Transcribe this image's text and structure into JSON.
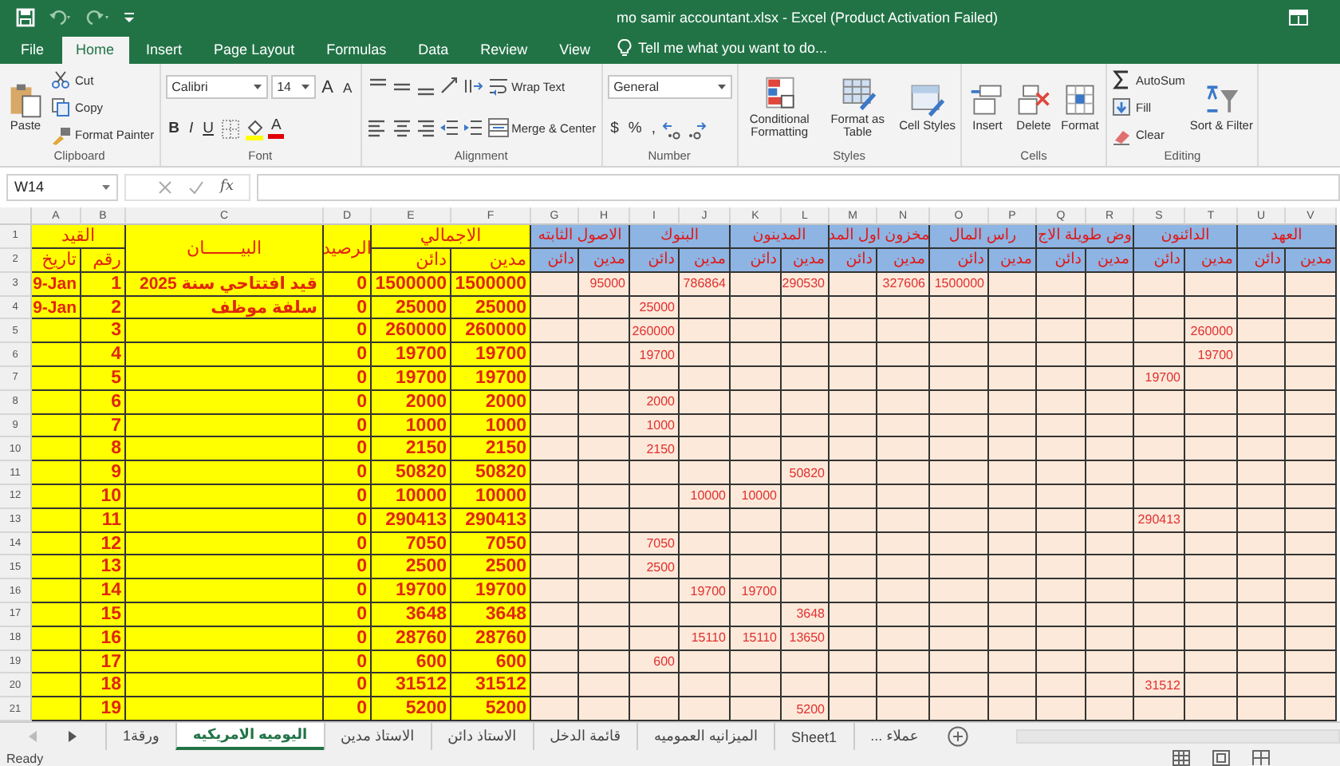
{
  "window": {
    "title": "mo samir accountant.xlsx - Excel (Product Activation Failed)"
  },
  "ribbon_tabs": [
    {
      "label": "File",
      "selected": false
    },
    {
      "label": "Home",
      "selected": true
    },
    {
      "label": "Insert",
      "selected": false
    },
    {
      "label": "Page Layout",
      "selected": false
    },
    {
      "label": "Formulas",
      "selected": false
    },
    {
      "label": "Data",
      "selected": false
    },
    {
      "label": "Review",
      "selected": false
    },
    {
      "label": "View",
      "selected": false
    }
  ],
  "tell_me": {
    "placeholder": "Tell me what you want to do..."
  },
  "ribbon": {
    "groups": [
      {
        "label": "Clipboard",
        "columns": [
          [
            {
              "kind": "large",
              "label": "Paste"
            }
          ],
          [
            {
              "kind": "small",
              "label": "Cut"
            },
            {
              "kind": "small",
              "label": "Copy"
            },
            {
              "kind": "small",
              "label": "Format Painter"
            }
          ]
        ]
      },
      {
        "label": "Font",
        "columns": [
          [
            {
              "kind": "tools",
              "tools": [
                {
                  "kind": "field",
                  "value": "Calibri"
                },
                {
                  "kind": "field",
                  "value": "14"
                },
                {
                  "kind": "text",
                  "label": "A"
                },
                {
                  "kind": "text",
                  "label": "A"
                }
              ]
            },
            {
              "kind": "tools",
              "tools": [
                {
                  "kind": "text",
                  "label": "B"
                },
                {
                  "kind": "text",
                  "label": "I"
                },
                {
                  "kind": "text",
                  "label": "U"
                },
                {
                  "kind": "icon"
                },
                {
                  "kind": "icon"
                },
                {
                  "kind": "swatch",
                  "label": "A"
                }
              ]
            }
          ]
        ]
      },
      {
        "label": "Alignment",
        "columns": [
          [
            {
              "kind": "tools",
              "tools": [
                {
                  "kind": "icon"
                },
                {
                  "kind": "icon"
                },
                {
                  "kind": "icon"
                },
                {
                  "kind": "icon"
                },
                {
                  "kind": "icon"
                }
              ]
            },
            {
              "kind": "tools",
              "tools": [
                {
                  "kind": "icon"
                },
                {
                  "kind": "icon"
                },
                {
                  "kind": "icon"
                },
                {
                  "kind": "icon"
                },
                {
                  "kind": "icon"
                }
              ]
            }
          ],
          [
            {
              "kind": "small",
              "label": "Wrap Text"
            },
            {
              "kind": "small",
              "label": "Merge & Center"
            }
          ]
        ]
      },
      {
        "label": "Number",
        "columns": [
          [
            {
              "kind": "tools",
              "tools": [
                {
                  "kind": "field",
                  "value": "General"
                }
              ]
            },
            {
              "kind": "tools",
              "tools": [
                {
                  "kind": "text",
                  "label": "$"
                },
                {
                  "kind": "text",
                  "label": "%"
                },
                {
                  "kind": "text",
                  "label": ","
                },
                {
                  "kind": "icon"
                },
                {
                  "kind": "icon"
                }
              ]
            }
          ]
        ]
      },
      {
        "label": "Styles",
        "columns": [
          [
            {
              "kind": "large",
              "label": "Conditional Formatting"
            }
          ],
          [
            {
              "kind": "large",
              "label": "Format as Table"
            }
          ],
          [
            {
              "kind": "large",
              "label": "Cell Styles"
            }
          ]
        ]
      },
      {
        "label": "Cells",
        "columns": [
          [
            {
              "kind": "large",
              "label": "Insert"
            }
          ],
          [
            {
              "kind": "large",
              "label": "Delete"
            }
          ],
          [
            {
              "kind": "large",
              "label": "Format"
            }
          ]
        ]
      },
      {
        "label": "Editing",
        "columns": [
          [
            {
              "kind": "small",
              "label": "AutoSum"
            },
            {
              "kind": "small",
              "label": "Fill"
            },
            {
              "kind": "small",
              "label": "Clear"
            }
          ],
          [
            {
              "kind": "large",
              "label": "Sort & Filter"
            }
          ]
        ]
      }
    ]
  },
  "formula_bar": {
    "name_box": "W14",
    "function_label": "fx"
  },
  "sheet": {
    "columns": [
      {
        "letter": "A",
        "kind": "journal"
      },
      {
        "letter": "B",
        "kind": "journal"
      },
      {
        "letter": "C",
        "kind": "journal"
      },
      {
        "letter": "D",
        "kind": "journal"
      },
      {
        "letter": "E",
        "kind": "journal"
      },
      {
        "letter": "F",
        "kind": "journal"
      },
      {
        "letter": "G",
        "kind": "account"
      },
      {
        "letter": "H",
        "kind": "account"
      },
      {
        "letter": "I",
        "kind": "account"
      },
      {
        "letter": "J",
        "kind": "account"
      },
      {
        "letter": "K",
        "kind": "account"
      },
      {
        "letter": "L",
        "kind": "account"
      },
      {
        "letter": "M",
        "kind": "account"
      },
      {
        "letter": "N",
        "kind": "account"
      },
      {
        "letter": "O",
        "kind": "account"
      },
      {
        "letter": "P",
        "kind": "account"
      },
      {
        "letter": "Q",
        "kind": "account"
      },
      {
        "letter": "R",
        "kind": "account"
      },
      {
        "letter": "S",
        "kind": "account"
      },
      {
        "letter": "T",
        "kind": "account"
      },
      {
        "letter": "U",
        "kind": "account"
      },
      {
        "letter": "V",
        "kind": "account"
      }
    ],
    "header": {
      "row_numbers": [
        "1",
        "2"
      ],
      "cells": [
        {
          "label": "العهد",
          "sub": [
            "مدين",
            "دائن"
          ]
        },
        {
          "label": "الدائنون",
          "sub": [
            "مدين",
            "دائن"
          ]
        },
        {
          "label": "وض طويلة الاج",
          "sub": [
            "مدين",
            "دائن"
          ]
        },
        {
          "label": "راس المال",
          "sub": [
            "مدين",
            "دائن"
          ]
        },
        {
          "label": "مخزون اول المد",
          "sub": [
            "مدين",
            "دائن"
          ]
        },
        {
          "label": "المدينون",
          "sub": [
            "مدين",
            "دائن"
          ]
        },
        {
          "label": "البنوك",
          "sub": [
            "مدين",
            "دائن"
          ]
        },
        {
          "label": "الاصول الثابته",
          "sub": [
            "مدين",
            "دائن"
          ]
        },
        {
          "label": "الاجمالي",
          "sub": [
            "مدين",
            "دائن"
          ]
        },
        {
          "label": "الرصيد"
        },
        {
          "label": "البيـــــــان"
        },
        {
          "label": "القيد",
          "sub": [
            "رقم",
            "تاريخ"
          ]
        }
      ]
    },
    "rows": [
      {
        "n": "3",
        "cells": {
          "A": "9-Jan",
          "B": "1",
          "C": "قيد افتتاحي سنة 2025",
          "D": "0",
          "E": "1500000",
          "F": "1500000",
          "H": "95000",
          "J": "786864",
          "L": "290530",
          "N": "327606",
          "O": "1500000"
        }
      },
      {
        "n": "4",
        "cells": {
          "A": "9-Jan",
          "B": "2",
          "C": "سلفة موظف",
          "D": "0",
          "E": "25000",
          "F": "25000",
          "I": "25000"
        }
      },
      {
        "n": "5",
        "cells": {
          "B": "3",
          "D": "0",
          "E": "260000",
          "F": "260000",
          "I": "260000",
          "T": "260000"
        }
      },
      {
        "n": "6",
        "cells": {
          "B": "4",
          "D": "0",
          "E": "19700",
          "F": "19700",
          "I": "19700",
          "T": "19700"
        }
      },
      {
        "n": "7",
        "cells": {
          "B": "5",
          "D": "0",
          "E": "19700",
          "F": "19700",
          "S": "19700"
        }
      },
      {
        "n": "8",
        "cells": {
          "B": "6",
          "D": "0",
          "E": "2000",
          "F": "2000",
          "I": "2000"
        }
      },
      {
        "n": "9",
        "cells": {
          "B": "7",
          "D": "0",
          "E": "1000",
          "F": "1000",
          "I": "1000"
        }
      },
      {
        "n": "10",
        "cells": {
          "B": "8",
          "D": "0",
          "E": "2150",
          "F": "2150",
          "I": "2150"
        }
      },
      {
        "n": "11",
        "cells": {
          "B": "9",
          "D": "0",
          "E": "50820",
          "F": "50820",
          "L": "50820"
        }
      },
      {
        "n": "12",
        "cells": {
          "B": "10",
          "D": "0",
          "E": "10000",
          "F": "10000",
          "J": "10000",
          "K": "10000"
        }
      },
      {
        "n": "13",
        "cells": {
          "B": "11",
          "D": "0",
          "E": "290413",
          "F": "290413",
          "S": "290413"
        }
      },
      {
        "n": "14",
        "cells": {
          "B": "12",
          "D": "0",
          "E": "7050",
          "F": "7050",
          "I": "7050"
        }
      },
      {
        "n": "15",
        "cells": {
          "B": "13",
          "D": "0",
          "E": "2500",
          "F": "2500",
          "I": "2500"
        }
      },
      {
        "n": "16",
        "cells": {
          "B": "14",
          "D": "0",
          "E": "19700",
          "F": "19700",
          "J": "19700",
          "K": "19700"
        }
      },
      {
        "n": "17",
        "cells": {
          "B": "15",
          "D": "0",
          "E": "3648",
          "F": "3648",
          "L": "3648"
        }
      },
      {
        "n": "18",
        "cells": {
          "B": "16",
          "D": "0",
          "E": "28760",
          "F": "28760",
          "J": "15110",
          "K": "15110",
          "L": "13650"
        }
      },
      {
        "n": "19",
        "cells": {
          "B": "17",
          "D": "0",
          "E": "600",
          "F": "600",
          "I": "600"
        }
      },
      {
        "n": "20",
        "cells": {
          "B": "18",
          "D": "0",
          "E": "31512",
          "F": "31512",
          "S": "31512"
        }
      },
      {
        "n": "21",
        "cells": {
          "B": "19",
          "D": "0",
          "E": "5200",
          "F": "5200",
          "L": "5200"
        }
      }
    ]
  },
  "sheet_tabs": [
    {
      "label": "... عملاء",
      "selected": false
    },
    {
      "label": "Sheet1",
      "selected": false
    },
    {
      "label": "الميزانيه العموميه",
      "selected": false
    },
    {
      "label": "قائمة الدخل",
      "selected": false
    },
    {
      "label": "الاستاذ دائن",
      "selected": false
    },
    {
      "label": "الاستاذ مدين",
      "selected": false
    },
    {
      "label": "اليوميه الامريكيه",
      "selected": true
    },
    {
      "label": "ورقة1",
      "selected": false
    }
  ],
  "status_bar": {
    "text": "Ready"
  }
}
